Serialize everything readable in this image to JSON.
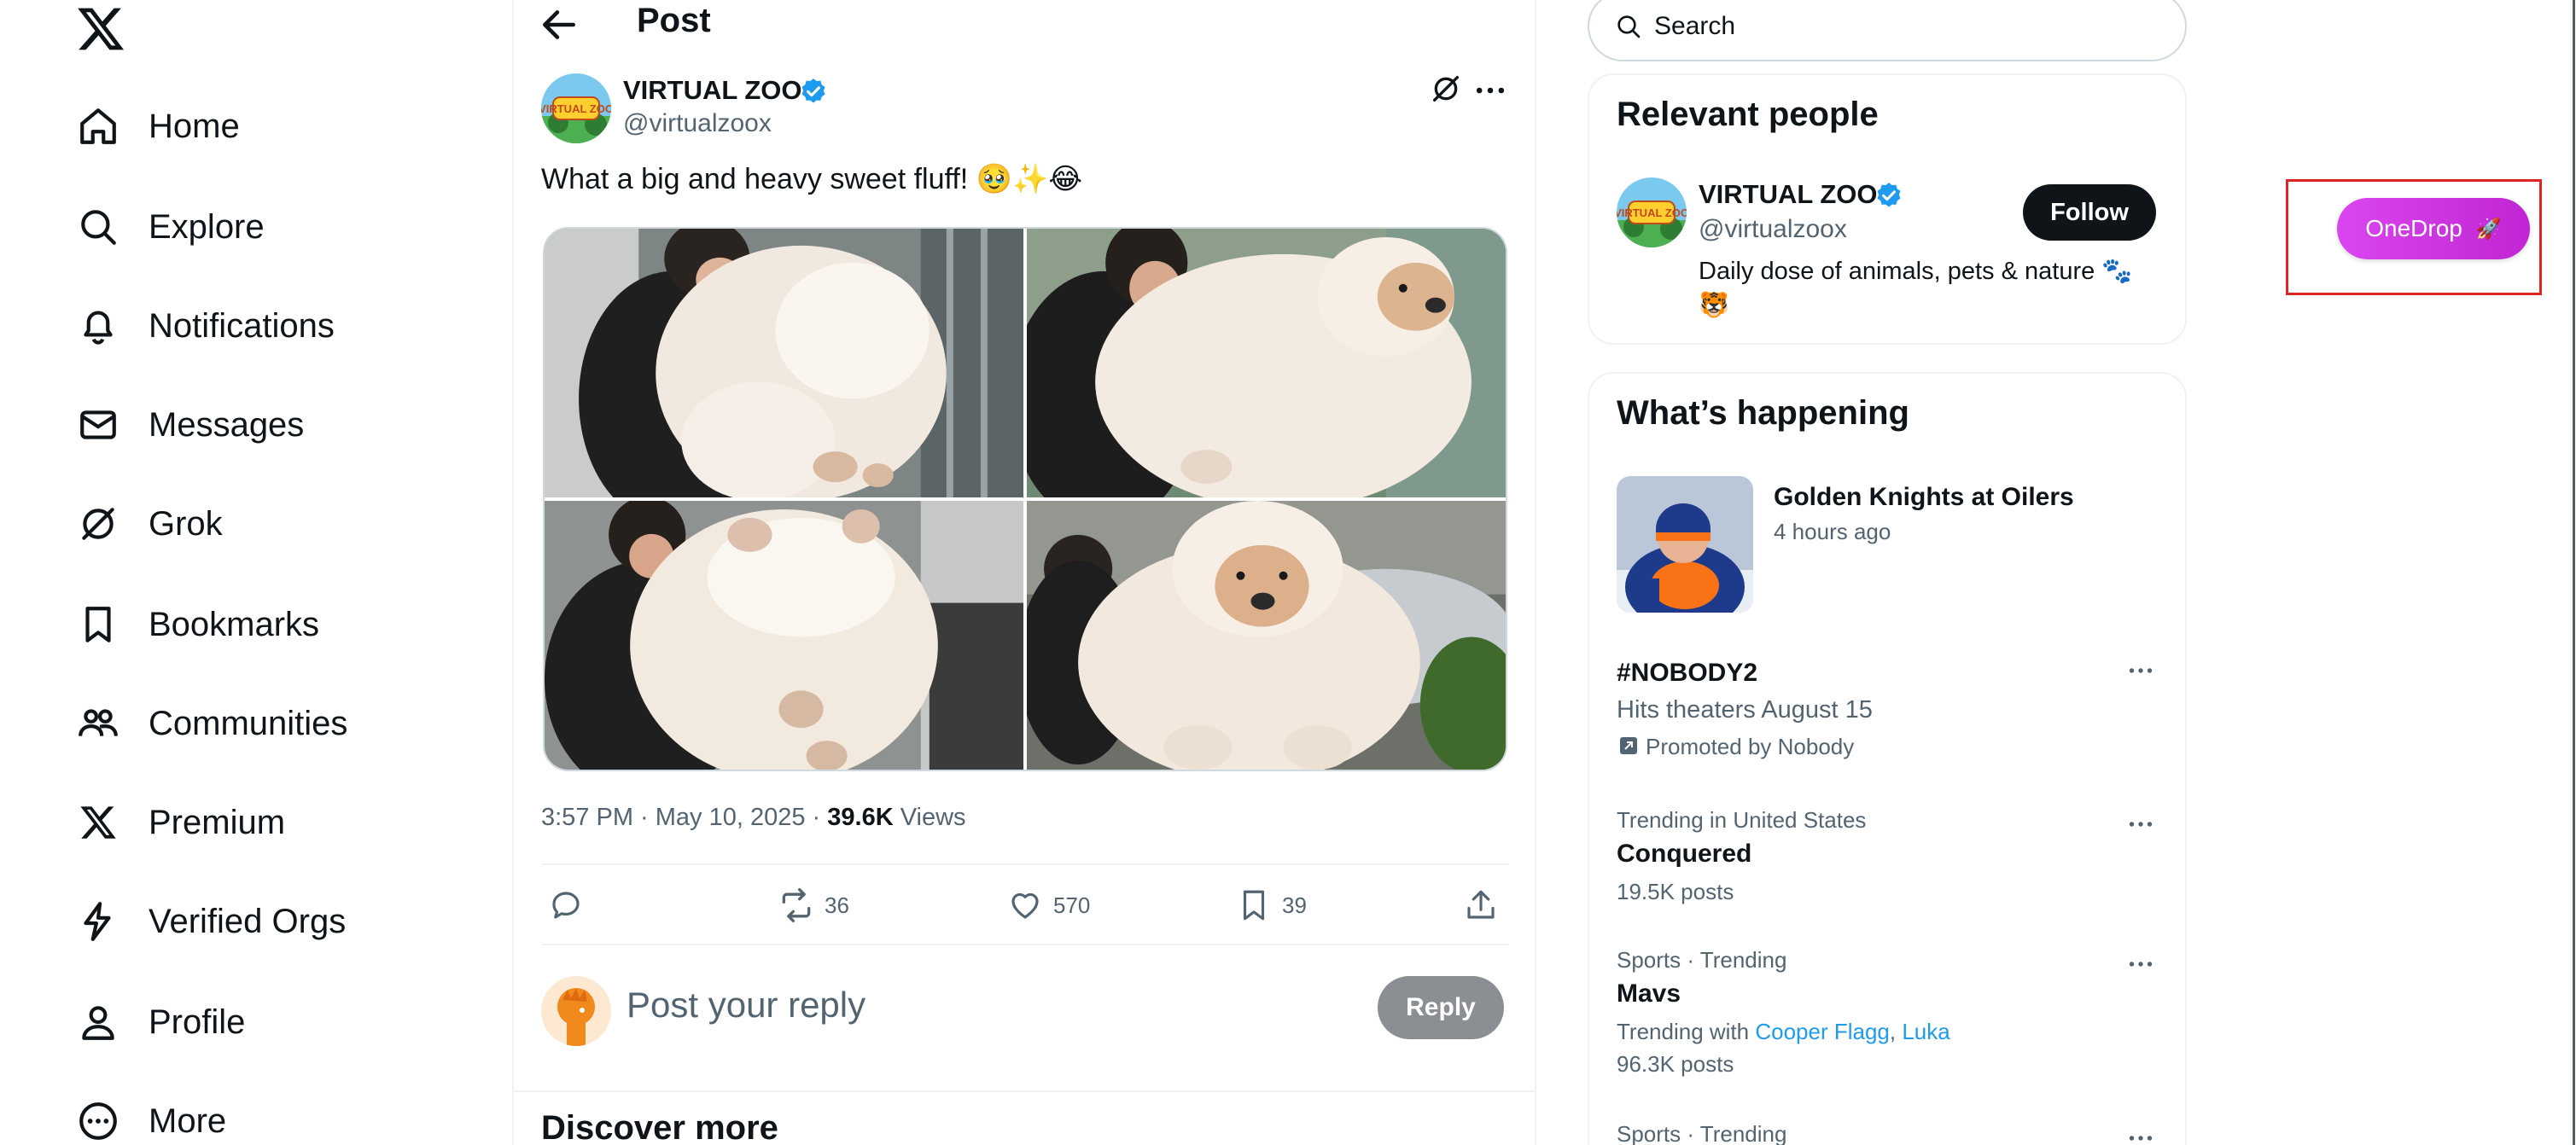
{
  "nav": {
    "items": [
      {
        "label": "Home",
        "icon": "home-icon"
      },
      {
        "label": "Explore",
        "icon": "search-icon"
      },
      {
        "label": "Notifications",
        "icon": "bell-icon"
      },
      {
        "label": "Messages",
        "icon": "envelope-icon"
      },
      {
        "label": "Grok",
        "icon": "grok-icon"
      },
      {
        "label": "Bookmarks",
        "icon": "bookmark-icon"
      },
      {
        "label": "Communities",
        "icon": "communities-icon"
      },
      {
        "label": "Premium",
        "icon": "x-logo-icon"
      },
      {
        "label": "Verified Orgs",
        "icon": "lightning-icon"
      },
      {
        "label": "Profile",
        "icon": "person-icon"
      },
      {
        "label": "More",
        "icon": "more-circle-icon"
      }
    ]
  },
  "header": {
    "title": "Post"
  },
  "post": {
    "author_name": "VIRTUAL ZOO",
    "handle": "@virtualzoox",
    "avatar_text": "VIRTUAL ZOO",
    "text": "What a big and heavy sweet fluff! 🥹✨😂",
    "time": "3:57 PM · May 10, 2025 · ",
    "views_count": "39.6K",
    "views_label": " Views",
    "reposts": "36",
    "likes": "570",
    "bookmarks": "39"
  },
  "reply": {
    "placeholder": "Post your reply",
    "button": "Reply"
  },
  "discover": {
    "title": "Discover more"
  },
  "search": {
    "placeholder": "Search"
  },
  "relevant": {
    "title": "Relevant people",
    "name": "VIRTUAL ZOO",
    "handle": "@virtualzoox",
    "follow": "Follow",
    "bio": "Daily dose of animals, pets & nature 🐾🐯"
  },
  "happening": {
    "title": "What’s happening",
    "event_title": "Golden Knights at Oilers",
    "event_time": "4 hours ago",
    "promo_name": "#NOBODY2",
    "promo_desc": "Hits theaters August 15",
    "promo_by": "Promoted by Nobody",
    "trends": [
      {
        "context": "Trending in United States",
        "name": "Conquered",
        "posts": "19.5K posts"
      },
      {
        "context": "Sports · Trending",
        "name": "Mavs",
        "with_prefix": "Trending with ",
        "with_1": "Cooper Flagg",
        "with_sep": ", ",
        "with_2": "Luka",
        "posts": "96.3K posts"
      },
      {
        "context": "Sports · Trending"
      }
    ]
  },
  "extension": {
    "label": "OneDrop",
    "emoji": "🚀"
  },
  "colors": {
    "accent": "#1d9bf0",
    "text": "#0f1419",
    "muted": "#536471",
    "reply_disabled": "#8b8f93",
    "extension": "#d946ef",
    "highlight": "#e02424"
  }
}
